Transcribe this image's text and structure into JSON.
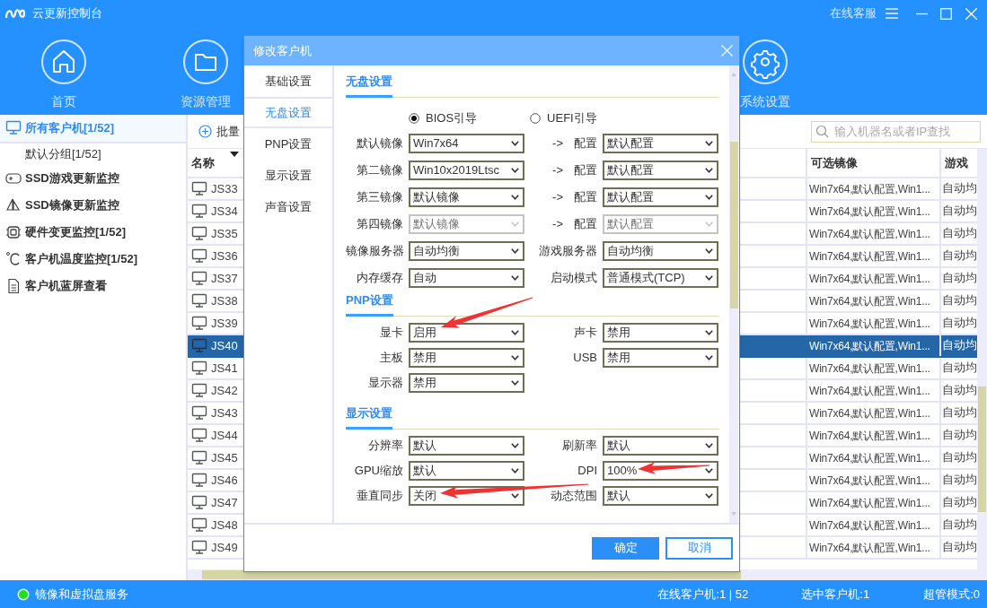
{
  "window": {
    "title": "云更新控制台",
    "support_link": "在线客服"
  },
  "nav": [
    {
      "label": "首页"
    },
    {
      "label": "资源管理"
    },
    {
      "label": "系统设置"
    }
  ],
  "sidebar": {
    "items": [
      {
        "label": "所有客户机[1/52]",
        "selected": true,
        "children": [
          {
            "label": "默认分组[1/52]",
            "selected": false
          }
        ]
      },
      {
        "label": "SSD游戏更新监控",
        "selected": false
      },
      {
        "label": "SSD镜像更新监控",
        "selected": false
      },
      {
        "label": "硬件变更监控[1/52]",
        "selected": false
      },
      {
        "label": "客户机温度监控[1/52]",
        "selected": false
      },
      {
        "label": "客户机蓝屏查看",
        "selected": false
      }
    ]
  },
  "toolbar": {
    "button": "批量"
  },
  "search": {
    "placeholder": "输入机器名或者IP查找"
  },
  "table": {
    "columns": [
      "名称",
      "可选镜像",
      "游戏"
    ],
    "rows": [
      {
        "name": "JS33",
        "image": "Win7x64,默认配置,Win1...",
        "server": "自动均",
        "selected": false
      },
      {
        "name": "JS34",
        "image": "Win7x64,默认配置,Win1...",
        "server": "自动均",
        "selected": false
      },
      {
        "name": "JS35",
        "image": "Win7x64,默认配置,Win1...",
        "server": "自动均",
        "selected": false
      },
      {
        "name": "JS36",
        "image": "Win7x64,默认配置,Win1...",
        "server": "自动均",
        "selected": false
      },
      {
        "name": "JS37",
        "image": "Win7x64,默认配置,Win1...",
        "server": "自动均",
        "selected": false
      },
      {
        "name": "JS38",
        "image": "Win7x64,默认配置,Win1...",
        "server": "自动均",
        "selected": false
      },
      {
        "name": "JS39",
        "image": "Win7x64,默认配置,Win1...",
        "server": "自动均",
        "selected": false
      },
      {
        "name": "JS40",
        "image": "Win7x64,默认配置,Win1...",
        "server": "自动均",
        "selected": true
      },
      {
        "name": "JS41",
        "image": "Win7x64,默认配置,Win1...",
        "server": "自动均",
        "selected": false
      },
      {
        "name": "JS42",
        "image": "Win7x64,默认配置,Win1...",
        "server": "自动均",
        "selected": false
      },
      {
        "name": "JS43",
        "image": "Win7x64,默认配置,Win1...",
        "server": "自动均",
        "selected": false
      },
      {
        "name": "JS44",
        "image": "Win7x64,默认配置,Win1...",
        "server": "自动均",
        "selected": false
      },
      {
        "name": "JS45",
        "image": "Win7x64,默认配置,Win1...",
        "server": "自动均",
        "selected": false
      },
      {
        "name": "JS46",
        "image": "Win7x64,默认配置,Win1...",
        "server": "自动均",
        "selected": false
      },
      {
        "name": "JS47",
        "image": "Win7x64,默认配置,Win1...",
        "server": "自动均",
        "selected": false
      },
      {
        "name": "JS48",
        "image": "Win7x64,默认配置,Win1...",
        "server": "自动均",
        "selected": false
      },
      {
        "name": "JS49",
        "image": "Win7x64,默认配置,Win1...",
        "server": "自动均",
        "selected": false
      }
    ]
  },
  "dialog": {
    "title": "修改客户机",
    "tabs": [
      {
        "label": "基础设置",
        "selected": false
      },
      {
        "label": "无盘设置",
        "selected": true
      },
      {
        "label": "PNP设置",
        "selected": false
      },
      {
        "label": "显示设置",
        "selected": false
      },
      {
        "label": "声音设置",
        "selected": false
      }
    ],
    "sections": [
      {
        "title": "无盘设置",
        "boot_options": [
          {
            "label": "BIOS引导",
            "selected": true
          },
          {
            "label": "UEFI引导",
            "selected": false
          }
        ],
        "rows": [
          {
            "left": {
              "label": "默认镜像",
              "value": "Win7x64",
              "disabled": false
            },
            "right": {
              "prefix": "->",
              "label": "配置",
              "value": "默认配置",
              "disabled": false
            }
          },
          {
            "left": {
              "label": "第二镜像",
              "value": "Win10x2019Ltsc",
              "disabled": false
            },
            "right": {
              "prefix": "->",
              "label": "配置",
              "value": "默认配置",
              "disabled": false
            }
          },
          {
            "left": {
              "label": "第三镜像",
              "value": "默认镜像",
              "disabled": false
            },
            "right": {
              "prefix": "->",
              "label": "配置",
              "value": "默认配置",
              "disabled": false
            }
          },
          {
            "left": {
              "label": "第四镜像",
              "value": "默认镜像",
              "disabled": true
            },
            "right": {
              "prefix": "->",
              "label": "配置",
              "value": "默认配置",
              "disabled": true
            }
          },
          {
            "left": {
              "label": "镜像服务器",
              "value": "自动均衡",
              "disabled": false
            },
            "right": {
              "label": "游戏服务器",
              "value": "自动均衡",
              "disabled": false
            }
          },
          {
            "left": {
              "label": "内存缓存",
              "value": "自动",
              "disabled": false
            },
            "right": {
              "label": "启动模式",
              "value": "普通模式(TCP)",
              "disabled": false
            }
          }
        ]
      },
      {
        "title": "PNP设置",
        "rows": [
          {
            "left": {
              "label": "显卡",
              "value": "启用",
              "disabled": false
            },
            "right": {
              "label": "声卡",
              "value": "禁用",
              "disabled": false
            }
          },
          {
            "left": {
              "label": "主板",
              "value": "禁用",
              "disabled": false
            },
            "right": {
              "label": "USB",
              "value": "禁用",
              "disabled": false
            }
          },
          {
            "left": {
              "label": "显示器",
              "value": "禁用",
              "disabled": false
            }
          }
        ]
      },
      {
        "title": "显示设置",
        "rows": [
          {
            "left": {
              "label": "分辨率",
              "value": "默认",
              "disabled": false
            },
            "right": {
              "label": "刷新率",
              "value": "默认",
              "disabled": false
            }
          },
          {
            "left": {
              "label": "GPU缩放",
              "value": "默认",
              "disabled": false
            },
            "right": {
              "label": "DPI",
              "value": "100%",
              "disabled": false
            }
          },
          {
            "left": {
              "label": "垂直同步",
              "value": "关闭",
              "disabled": false
            },
            "right": {
              "label": "动态范围",
              "value": "默认",
              "disabled": false
            }
          }
        ]
      }
    ],
    "buttons": [
      {
        "label": "确定",
        "kind": "primary"
      },
      {
        "label": "取消",
        "kind": "secondary"
      }
    ]
  },
  "status_bar": {
    "service": "镜像和虚拟盘服务",
    "online": "在线客户机:1 | 52",
    "selected": "选中客户机:1",
    "mode": "超管模式:0"
  }
}
